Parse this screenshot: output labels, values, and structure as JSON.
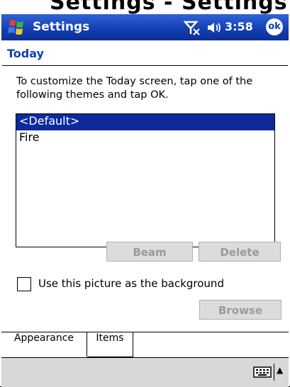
{
  "window": {
    "title": "Settings",
    "clock": "3:58",
    "ok_label": "ok",
    "cutoff_title": "Settings - Settings"
  },
  "page": {
    "title": "Today",
    "instructions": "To customize the Today screen, tap one of the following themes and tap OK."
  },
  "themes": {
    "items": [
      "<Default>",
      "Fire"
    ],
    "selected": "<Default>"
  },
  "buttons": {
    "beam": "Beam",
    "delete": "Delete",
    "browse": "Browse"
  },
  "background_option": {
    "label": "Use this picture as the background",
    "checked": false
  },
  "tabs": [
    {
      "label": "Appearance",
      "active": true
    },
    {
      "label": "Items",
      "active": false
    }
  ],
  "colors": {
    "titlebar": "#1440b4",
    "selection": "#0d2a9c",
    "heading": "#1440b4"
  },
  "icons": {
    "start": "windows-flag-icon",
    "signal": "no-signal-antenna-icon",
    "volume": "speaker-icon",
    "keyboard": "keyboard-icon",
    "sip_arrow": "up-arrow-icon"
  }
}
